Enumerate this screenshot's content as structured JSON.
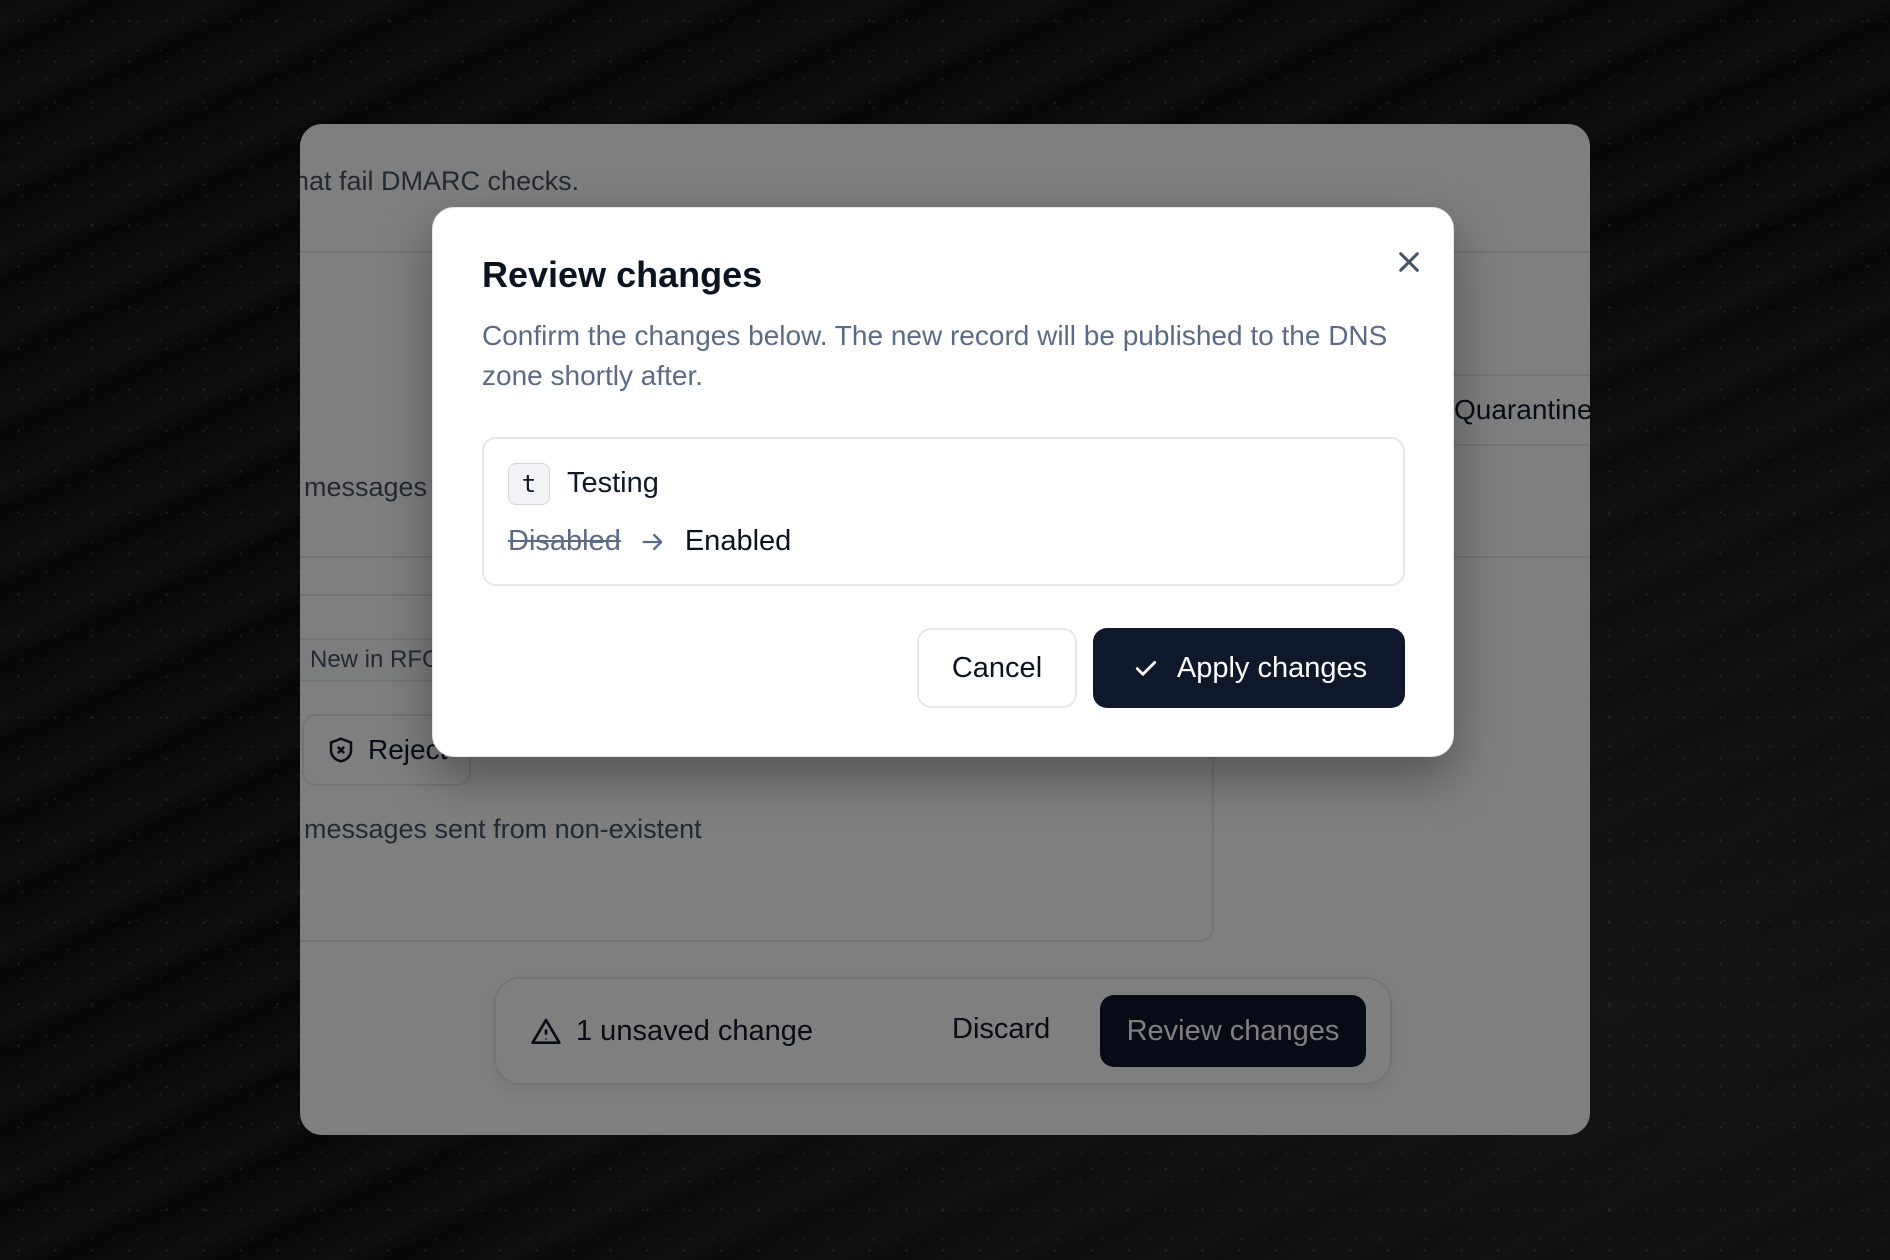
{
  "background": {
    "top_text": "hat fail DMARC checks.",
    "quarantine_label": "Quarantine",
    "messages_text": "messages",
    "tag_label": "New in RFC",
    "reject_label": "Reject",
    "bottom_text": "messages sent from non-existent"
  },
  "savebar": {
    "unsaved_label": "1 unsaved change",
    "discard_label": "Discard",
    "review_label": "Review changes"
  },
  "dialog": {
    "title": "Review changes",
    "description": "Confirm the changes below. The new record will be published to the DNS zone shortly after.",
    "change": {
      "key": "t",
      "field": "Testing",
      "old_value": "Disabled",
      "new_value": "Enabled"
    },
    "cancel_label": "Cancel",
    "apply_label": "Apply changes"
  }
}
